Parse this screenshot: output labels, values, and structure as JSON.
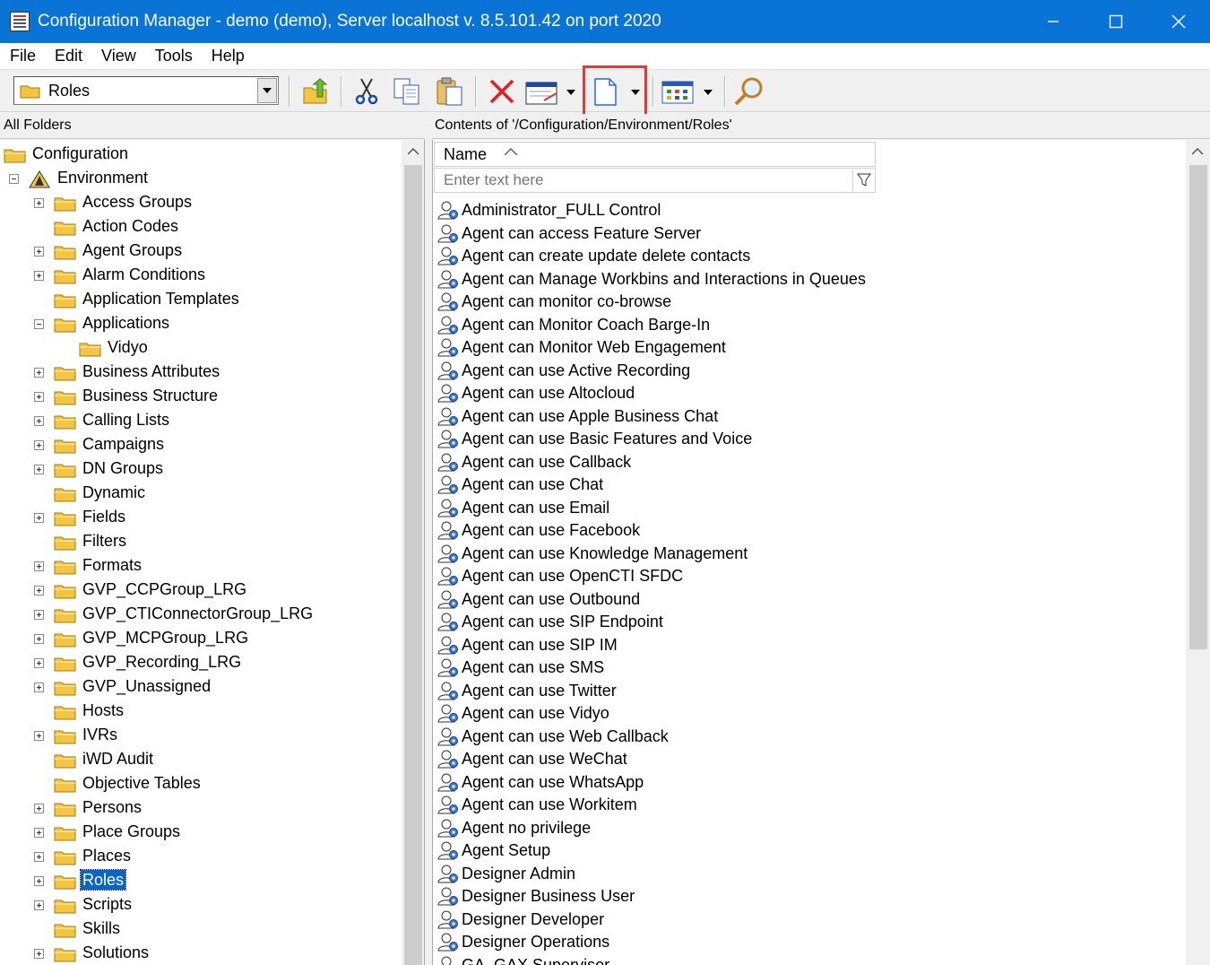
{
  "window": {
    "title": "Configuration Manager - demo  (demo), Server localhost v. 8.5.101.42 on port 2020"
  },
  "menu": [
    "File",
    "Edit",
    "View",
    "Tools",
    "Help"
  ],
  "toolbar": {
    "folder_combo_value": "Roles",
    "buttons": [
      "up-one-level",
      "cut",
      "copy",
      "paste",
      "delete",
      "properties",
      "new",
      "view-options",
      "find"
    ],
    "highlighted_button": "new"
  },
  "left_panel": {
    "header": "All Folders",
    "tree": [
      {
        "label": "Configuration",
        "level": 0,
        "expander": "",
        "icon": "folder"
      },
      {
        "label": "Environment",
        "level": 1,
        "expander": "minus",
        "icon": "environment"
      },
      {
        "label": "Access Groups",
        "level": 2,
        "expander": "plus",
        "icon": "folder"
      },
      {
        "label": "Action Codes",
        "level": 2,
        "expander": "",
        "icon": "folder"
      },
      {
        "label": "Agent Groups",
        "level": 2,
        "expander": "plus",
        "icon": "folder"
      },
      {
        "label": "Alarm Conditions",
        "level": 2,
        "expander": "plus",
        "icon": "folder"
      },
      {
        "label": "Application Templates",
        "level": 2,
        "expander": "",
        "icon": "folder"
      },
      {
        "label": "Applications",
        "level": 2,
        "expander": "minus",
        "icon": "folder"
      },
      {
        "label": "Vidyo",
        "level": 3,
        "expander": "",
        "icon": "folder"
      },
      {
        "label": "Business Attributes",
        "level": 2,
        "expander": "plus",
        "icon": "folder"
      },
      {
        "label": "Business Structure",
        "level": 2,
        "expander": "plus",
        "icon": "folder"
      },
      {
        "label": "Calling Lists",
        "level": 2,
        "expander": "plus",
        "icon": "folder"
      },
      {
        "label": "Campaigns",
        "level": 2,
        "expander": "plus",
        "icon": "folder"
      },
      {
        "label": "DN Groups",
        "level": 2,
        "expander": "plus",
        "icon": "folder"
      },
      {
        "label": "Dynamic",
        "level": 2,
        "expander": "",
        "icon": "folder"
      },
      {
        "label": "Fields",
        "level": 2,
        "expander": "plus",
        "icon": "folder"
      },
      {
        "label": "Filters",
        "level": 2,
        "expander": "",
        "icon": "folder"
      },
      {
        "label": "Formats",
        "level": 2,
        "expander": "plus",
        "icon": "folder"
      },
      {
        "label": "GVP_CCPGroup_LRG",
        "level": 2,
        "expander": "plus",
        "icon": "folder"
      },
      {
        "label": "GVP_CTIConnectorGroup_LRG",
        "level": 2,
        "expander": "plus",
        "icon": "folder"
      },
      {
        "label": "GVP_MCPGroup_LRG",
        "level": 2,
        "expander": "plus",
        "icon": "folder"
      },
      {
        "label": "GVP_Recording_LRG",
        "level": 2,
        "expander": "plus",
        "icon": "folder"
      },
      {
        "label": "GVP_Unassigned",
        "level": 2,
        "expander": "plus",
        "icon": "folder"
      },
      {
        "label": "Hosts",
        "level": 2,
        "expander": "",
        "icon": "folder"
      },
      {
        "label": "IVRs",
        "level": 2,
        "expander": "plus",
        "icon": "folder"
      },
      {
        "label": "iWD Audit",
        "level": 2,
        "expander": "",
        "icon": "folder"
      },
      {
        "label": "Objective Tables",
        "level": 2,
        "expander": "",
        "icon": "folder"
      },
      {
        "label": "Persons",
        "level": 2,
        "expander": "plus",
        "icon": "folder"
      },
      {
        "label": "Place Groups",
        "level": 2,
        "expander": "plus",
        "icon": "folder"
      },
      {
        "label": "Places",
        "level": 2,
        "expander": "plus",
        "icon": "folder"
      },
      {
        "label": "Roles",
        "level": 2,
        "expander": "plus",
        "icon": "folder",
        "selected": true
      },
      {
        "label": "Scripts",
        "level": 2,
        "expander": "plus",
        "icon": "folder"
      },
      {
        "label": "Skills",
        "level": 2,
        "expander": "",
        "icon": "folder"
      },
      {
        "label": "Solutions",
        "level": 2,
        "expander": "plus",
        "icon": "folder"
      }
    ]
  },
  "right_panel": {
    "header": "Contents of '/Configuration/Environment/Roles'",
    "column_name": "Name",
    "filter_placeholder": "Enter text here",
    "items": [
      "Administrator_FULL Control",
      "Agent can access Feature Server",
      "Agent can create update delete contacts",
      "Agent can Manage Workbins and Interactions in Queues",
      "Agent can monitor co-browse",
      "Agent can Monitor Coach Barge-In",
      "Agent can Monitor Web Engagement",
      "Agent can use Active Recording",
      "Agent can use Altocloud",
      "Agent can use Apple Business Chat",
      "Agent can use Basic Features and Voice",
      "Agent can use Callback",
      "Agent can use Chat",
      "Agent can use Email",
      "Agent can use Facebook",
      "Agent can use Knowledge Management",
      "Agent can use OpenCTI SFDC",
      "Agent can use Outbound",
      "Agent can use SIP Endpoint",
      "Agent can use SIP IM",
      "Agent can use SMS",
      "Agent can use Twitter",
      "Agent can use Vidyo",
      "Agent can use Web Callback",
      "Agent can use WeChat",
      "Agent can use WhatsApp",
      "Agent can use Workitem",
      "Agent no privilege",
      "Agent Setup",
      "Designer Admin",
      "Designer Business User",
      "Designer Developer",
      "Designer Operations",
      "GA_GAX Supervisor"
    ]
  },
  "colors": {
    "titlebar": "#0a74d6",
    "selection": "#0a64c8",
    "highlight_box": "#e53935",
    "folder": "#f4c542"
  }
}
